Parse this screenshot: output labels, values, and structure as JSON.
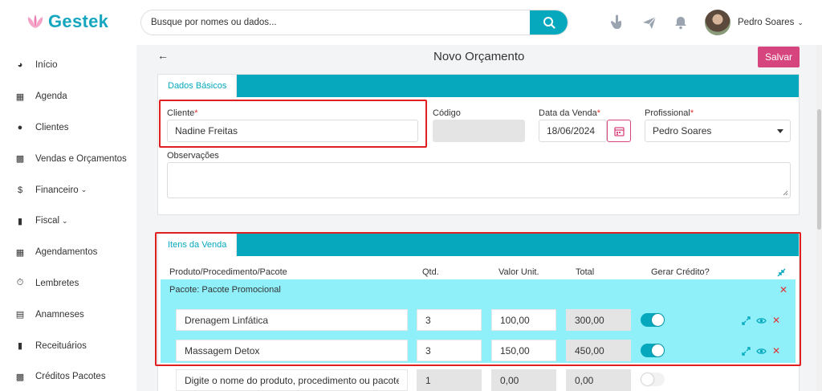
{
  "app": {
    "name": "Gestek",
    "brand_color": "#06a8bd",
    "accent_color": "#d6457d"
  },
  "search": {
    "placeholder": "Busque por nomes ou dados..."
  },
  "user": {
    "name": "Pedro Soares"
  },
  "sidebar": {
    "items": [
      {
        "label": "Início",
        "icon": "dashboard-icon"
      },
      {
        "label": "Agenda",
        "icon": "calendar-icon"
      },
      {
        "label": "Clientes",
        "icon": "users-icon"
      },
      {
        "label": "Vendas e Orçamentos",
        "icon": "shopping-bag-icon"
      },
      {
        "label": "Financeiro",
        "icon": "dollar-icon",
        "expandable": true
      },
      {
        "label": "Fiscal",
        "icon": "document-icon",
        "expandable": true
      },
      {
        "label": "Agendamentos",
        "icon": "calendar-icon"
      },
      {
        "label": "Lembretes",
        "icon": "stopwatch-icon"
      },
      {
        "label": "Anamneses",
        "icon": "id-card-icon"
      },
      {
        "label": "Receituários",
        "icon": "document-icon"
      },
      {
        "label": "Créditos Pacotes",
        "icon": "tickets-icon"
      }
    ]
  },
  "page": {
    "title": "Novo Orçamento",
    "save_label": "Salvar"
  },
  "basic": {
    "tab_label": "Dados Básicos",
    "cliente_label": "Cliente",
    "cliente_value": "Nadine Freitas",
    "codigo_label": "Código",
    "data_label": "Data da Venda",
    "data_value": "18/06/2024",
    "profissional_label": "Profissional",
    "profissional_value": "Pedro Soares",
    "observacoes_label": "Observações",
    "required_mark": "*"
  },
  "items_section": {
    "tab_label": "Itens da Venda",
    "columns": {
      "produto": "Produto/Procedimento/Pacote",
      "qtd": "Qtd.",
      "valor": "Valor Unit.",
      "total": "Total",
      "credito": "Gerar Crédito?"
    },
    "package": {
      "title": "Pacote: Pacote Promocional",
      "rows": [
        {
          "name": "Drenagem Linfática",
          "qty": "3",
          "unit": "100,00",
          "total": "300,00",
          "credit": true
        },
        {
          "name": "Massagem Detox",
          "qty": "3",
          "unit": "150,00",
          "total": "450,00",
          "credit": true
        }
      ]
    },
    "new_row": {
      "placeholder": "Digite o nome do produto, procedimento ou pacote",
      "qty": "1",
      "unit": "0,00",
      "total": "0,00",
      "credit": false
    }
  }
}
